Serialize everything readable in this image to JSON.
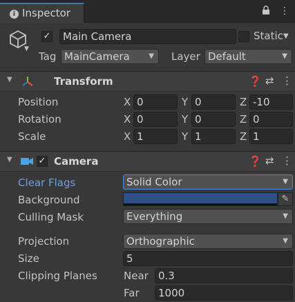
{
  "tab": {
    "label": "Inspector",
    "icon": "info-icon"
  },
  "gameobject": {
    "name": "Main Camera",
    "active": true,
    "static_label": "Static",
    "static_checked": false,
    "tag_label": "Tag",
    "tag_value": "MainCamera",
    "layer_label": "Layer",
    "layer_value": "Default"
  },
  "transform": {
    "title": "Transform",
    "rows": [
      {
        "label": "Position",
        "x": "0",
        "y": "0",
        "z": "-10"
      },
      {
        "label": "Rotation",
        "x": "0",
        "y": "0",
        "z": "0"
      },
      {
        "label": "Scale",
        "x": "1",
        "y": "1",
        "z": "1"
      }
    ],
    "axes": {
      "x": "X",
      "y": "Y",
      "z": "Z"
    }
  },
  "camera": {
    "title": "Camera",
    "enabled": true,
    "clear_flags_label": "Clear Flags",
    "clear_flags_value": "Solid Color",
    "background_label": "Background",
    "background_color": "#2f4f8a",
    "culling_mask_label": "Culling Mask",
    "culling_mask_value": "Everything",
    "projection_label": "Projection",
    "projection_value": "Orthographic",
    "size_label": "Size",
    "size_value": "5",
    "clipping_label": "Clipping Planes",
    "near_label": "Near",
    "near_value": "0.3",
    "far_label": "Far",
    "far_value": "1000"
  },
  "colors": {
    "accent": "#3a79bb",
    "highlight_label": "#6fa0e0"
  }
}
